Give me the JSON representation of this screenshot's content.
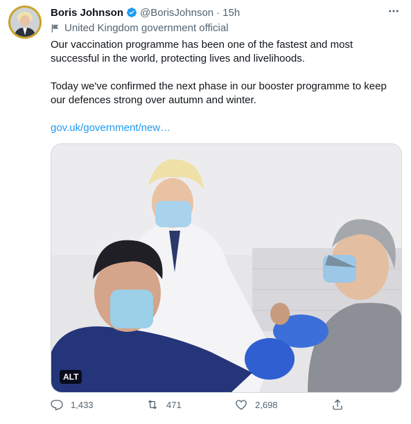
{
  "tweet": {
    "author_name": "Boris Johnson",
    "handle": "@BorisJohnson",
    "separator": "·",
    "time": "15h",
    "label": "United Kingdom government official",
    "text_p1": "Our vaccination programme has been one of the fastest and most successful in the world, protecting lives and livelihoods.",
    "text_p2": "Today we've confirmed the next phase in our booster programme to keep our defences strong over autumn and winter.",
    "link": "gov.uk/government/new…",
    "alt_badge": "ALT",
    "more_icon": "more-icon",
    "colors": {
      "accent": "#1d9bf0",
      "secondary": "#536471"
    }
  },
  "actions": {
    "replies": "1,433",
    "retweets": "471",
    "likes": "2,698"
  }
}
